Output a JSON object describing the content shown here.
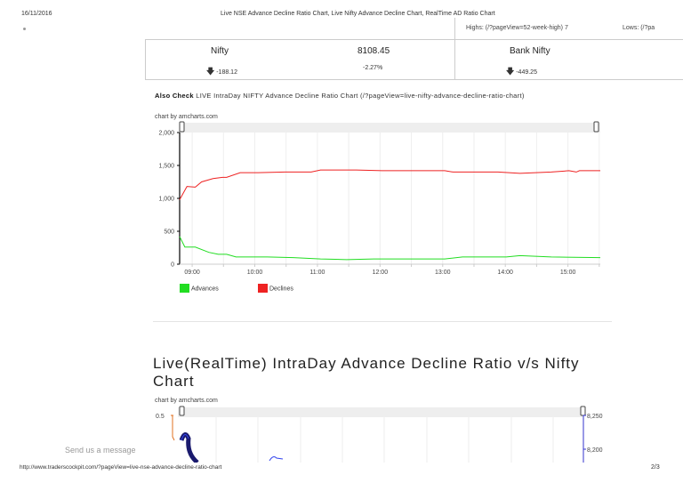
{
  "header": {
    "date": "16/11/2016",
    "title": "Live NSE Advance Decline Ratio Chart, Live Nifty Advance Decline Chart, RealTime AD Ratio Chart"
  },
  "topbar": {
    "highs": "Highs: (/?pageView=52-week-high) 7",
    "lows": "Lows: (/?pa"
  },
  "nifty": {
    "name": "Nifty",
    "value": "8108.45",
    "change": "-188.12",
    "percent": "-2.27%"
  },
  "banknifty": {
    "name": "Bank Nifty",
    "change": "-449.25"
  },
  "also_check": {
    "label": "Also Check",
    "link": "LIVE IntraDay NIFTY Advance Decline Ratio Chart (/?pageView=live-nifty-advance-decline-ratio-chart)"
  },
  "chart_credit": "chart by amcharts.com",
  "chart_data": [
    {
      "type": "line",
      "ylim": [
        0,
        2000
      ],
      "y_ticks": [
        "0",
        "500",
        "1,000",
        "1,500",
        "2,000"
      ],
      "x_ticks": [
        "09:00",
        "10:00",
        "11:00",
        "12:00",
        "13:00",
        "14:00",
        "15:00"
      ],
      "x_range": [
        "08:48",
        "15:31"
      ],
      "grid": true,
      "legend": "bottom-left",
      "series": [
        {
          "name": "Advances",
          "color": "#22dd22",
          "points": [
            [
              "08:48",
              420
            ],
            [
              "08:53",
              260
            ],
            [
              "09:03",
              260
            ],
            [
              "09:16",
              180
            ],
            [
              "09:25",
              150
            ],
            [
              "09:33",
              150
            ],
            [
              "09:42",
              110
            ],
            [
              "10:12",
              110
            ],
            [
              "10:37",
              100
            ],
            [
              "11:03",
              80
            ],
            [
              "11:28",
              70
            ],
            [
              "11:54",
              80
            ],
            [
              "13:02",
              80
            ],
            [
              "13:19",
              110
            ],
            [
              "14:01",
              110
            ],
            [
              "14:14",
              130
            ],
            [
              "14:44",
              110
            ],
            [
              "15:31",
              100
            ]
          ]
        },
        {
          "name": "Declines",
          "color": "#ee2222",
          "points": [
            [
              "08:48",
              980
            ],
            [
              "08:55",
              1180
            ],
            [
              "09:03",
              1170
            ],
            [
              "09:09",
              1250
            ],
            [
              "09:20",
              1300
            ],
            [
              "09:29",
              1320
            ],
            [
              "09:33",
              1320
            ],
            [
              "09:46",
              1390
            ],
            [
              "10:03",
              1390
            ],
            [
              "10:29",
              1400
            ],
            [
              "10:54",
              1400
            ],
            [
              "11:03",
              1430
            ],
            [
              "11:37",
              1430
            ],
            [
              "12:02",
              1420
            ],
            [
              "13:02",
              1420
            ],
            [
              "13:10",
              1400
            ],
            [
              "13:53",
              1400
            ],
            [
              "14:14",
              1380
            ],
            [
              "14:44",
              1400
            ],
            [
              "15:01",
              1420
            ],
            [
              "15:08",
              1400
            ],
            [
              "15:11",
              1420
            ],
            [
              "15:31",
              1420
            ]
          ]
        }
      ]
    },
    {
      "type": "line",
      "title": "Live(RealTime) IntraDay Advance Decline Ratio v/s Nifty Chart",
      "left_ticks": [
        "0.5"
      ],
      "right_ticks": [
        "8,250",
        "8,200"
      ]
    }
  ],
  "chat": {
    "placeholder": "Send us a message"
  },
  "footer": {
    "url": "http://www.traderscockpit.com/?pageView=live-nse-advance-decline-ratio-chart",
    "page": "2/3"
  }
}
